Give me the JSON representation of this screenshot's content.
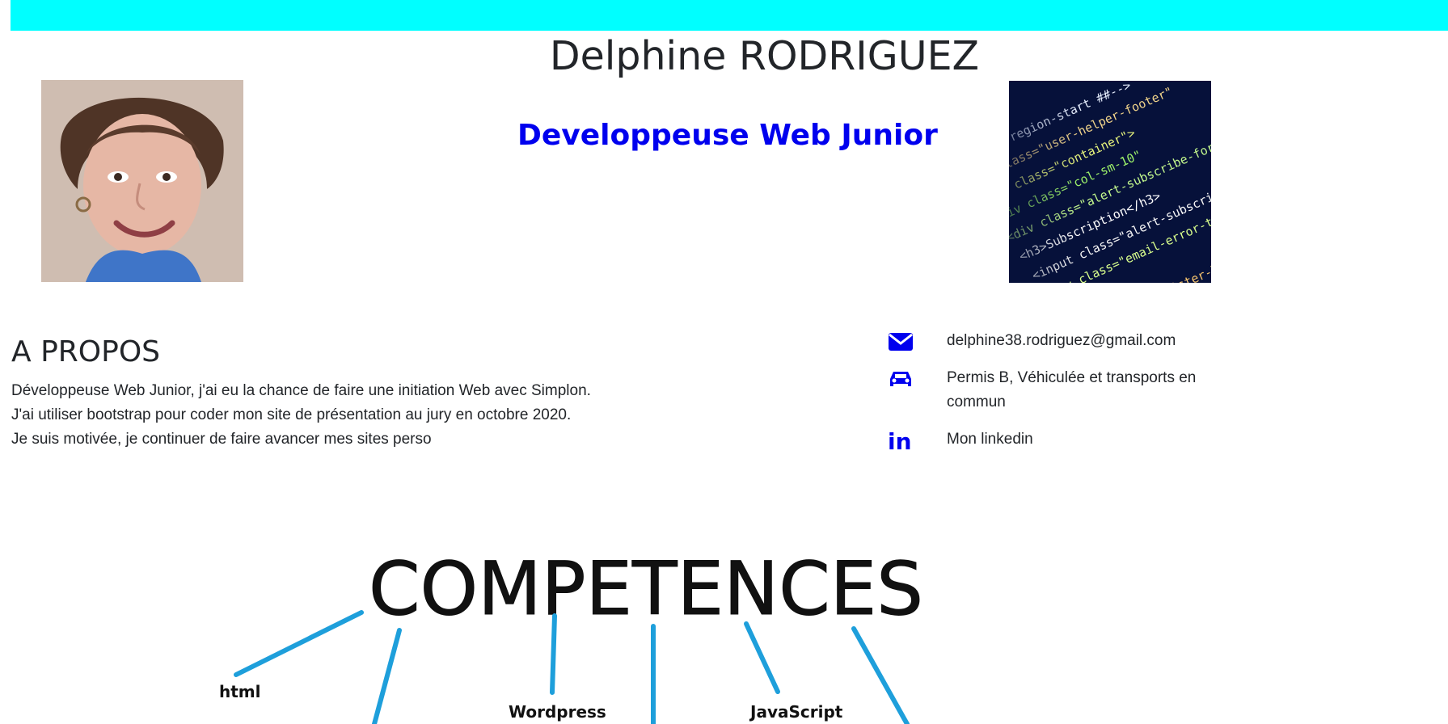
{
  "header": {
    "name": "Delphine RODRIGUEZ",
    "subtitle": "Developpeuse Web Junior"
  },
  "about": {
    "title": "A PROPOS",
    "lines": [
      "Développeuse Web Junior, j'ai eu la chance de faire une initiation Web avec Simplon.",
      "J'ai utiliser bootstrap pour coder mon site de présentation au jury en octobre 2020.",
      "Je suis motivée, je continuer de faire avancer mes sites perso"
    ]
  },
  "contact": {
    "email": "delphine38.rodriguez@gmail.com",
    "mobility": "Permis B, Véhiculée et transports en commun",
    "linkedin": "Mon linkedin"
  },
  "skills": {
    "title": "COMPETENCES",
    "items": [
      "html",
      "Wordpress",
      "JavaScript"
    ]
  },
  "colors": {
    "top_bar": "#00ffff",
    "accent": "#0000ee",
    "text": "#222529",
    "skill_lines": "#1e9fdb"
  },
  "icons": [
    "envelope-icon",
    "car-icon",
    "linkedin-icon"
  ]
}
